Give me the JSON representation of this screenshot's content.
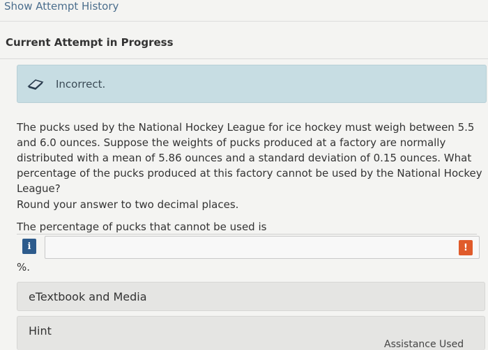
{
  "header": {
    "history_link": "Show Attempt History",
    "attempt_title": "Current Attempt in Progress"
  },
  "feedback": {
    "icon": "eraser-icon",
    "text": "Incorrect."
  },
  "question": {
    "text": "The pucks used by the National Hockey League for ice hockey must weigh between 5.5 and 6.0 ounces. Suppose the weights of pucks produced at a factory are normally distributed with a mean of 5.86 ounces and a standard deviation of 0.15 ounces. What percentage of the pucks produced at this factory cannot be used by the National Hockey League?",
    "instruction": "Round your answer to two decimal places.",
    "answer_label": "The percentage of pucks that cannot be used is",
    "answer_value": "",
    "info_badge": "i",
    "alert_badge": "!",
    "unit": "%."
  },
  "resources": {
    "etextbook_label": "eTextbook and Media",
    "hint_label": "Hint",
    "assistance_label": "Assistance Used"
  },
  "colors": {
    "feedback_bg": "#c7dde3",
    "info_badge": "#2d5b8c",
    "alert_badge": "#e05b2b",
    "link": "#4a6d8c"
  }
}
